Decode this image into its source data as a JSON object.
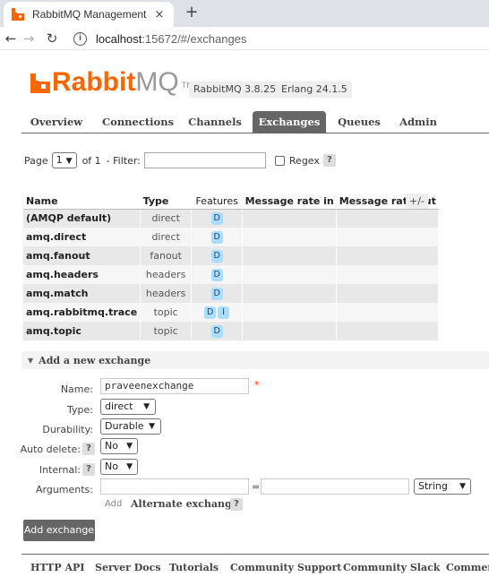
{
  "browser": {
    "tab_title": "RabbitMQ Management",
    "tab_close": "×",
    "new_tab": "+",
    "url_host": "localhost",
    "url_path": ":15672/#/exchanges"
  },
  "header": {
    "logo_rabbit": "Rabbit",
    "logo_mq": "MQ",
    "logo_tm": "TM",
    "version_rabbitmq": "RabbitMQ 3.8.25",
    "version_erlang": "Erlang 24.1.5",
    "brand_color": "#ff6600"
  },
  "nav": {
    "tabs": [
      "Overview",
      "Connections",
      "Channels",
      "Exchanges",
      "Queues",
      "Admin"
    ],
    "active": "Exchanges"
  },
  "paging": {
    "page_label": "Page",
    "page_value": "1",
    "of_label": "of 1",
    "filter_label": "- Filter:",
    "regex_label": "Regex",
    "help": "?"
  },
  "table": {
    "headers": {
      "name": "Name",
      "type": "Type",
      "features": "Features",
      "rate_in": "Message rate in",
      "rate_out": "Message rate out",
      "toggle": "+/-"
    },
    "rows": [
      {
        "name": "(AMQP default)",
        "type": "direct",
        "features": [
          "D"
        ]
      },
      {
        "name": "amq.direct",
        "type": "direct",
        "features": [
          "D"
        ]
      },
      {
        "name": "amq.fanout",
        "type": "fanout",
        "features": [
          "D"
        ]
      },
      {
        "name": "amq.headers",
        "type": "headers",
        "features": [
          "D"
        ]
      },
      {
        "name": "amq.match",
        "type": "headers",
        "features": [
          "D"
        ]
      },
      {
        "name": "amq.rabbitmq.trace",
        "type": "topic",
        "features": [
          "D",
          "I"
        ]
      },
      {
        "name": "amq.topic",
        "type": "topic",
        "features": [
          "D"
        ]
      }
    ]
  },
  "add_form": {
    "section_title": "Add a new exchange",
    "name_label": "Name:",
    "name_value": "praveenexchange",
    "required_mark": "*",
    "type_label": "Type:",
    "type_value": "direct",
    "durability_label": "Durability:",
    "durability_value": "Durable",
    "auto_delete_label": "Auto delete:",
    "auto_delete_value": "No",
    "internal_label": "Internal:",
    "internal_value": "No",
    "arguments_label": "Arguments:",
    "equals": "=",
    "arg_type_value": "String",
    "add_link": "Add",
    "alternate_exchange": "Alternate exchange",
    "help": "?",
    "submit_label": "Add exchange"
  },
  "footer": {
    "links": [
      "HTTP API",
      "Server Docs",
      "Tutorials",
      "Community Support",
      "Community Slack",
      "Commerc"
    ]
  }
}
